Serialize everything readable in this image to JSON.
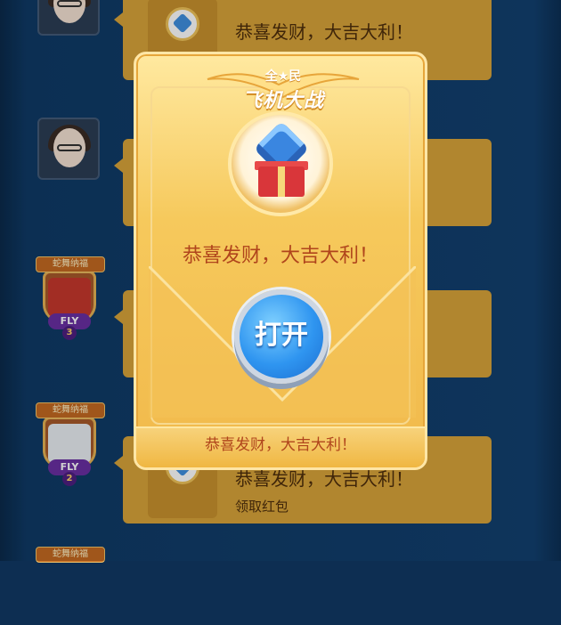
{
  "chat": {
    "messages": [
      {
        "title": "恭喜发财，大吉大利！",
        "subtitle": ""
      },
      {
        "title": "",
        "subtitle": ""
      },
      {
        "title": "",
        "subtitle": ""
      },
      {
        "title": "恭喜发财，大吉大利！",
        "subtitle": "领取红包"
      }
    ],
    "frames": [
      {
        "badge": "蛇舞纳福",
        "fly": "FLY",
        "level": "3"
      },
      {
        "badge": "蛇舞纳福",
        "fly": "FLY",
        "level": "2"
      },
      {
        "badge": "蛇舞纳福"
      }
    ]
  },
  "dialog": {
    "logo_top": "全★民",
    "logo_main": "飞机大战",
    "message": "恭喜发财，大吉大利！",
    "open_label": "打开",
    "footer": "恭喜发财，大吉大利！"
  },
  "colors": {
    "accent_blue": "#2f95f0",
    "dialog_gold": "#f6c95c",
    "text_red": "#b0451c"
  },
  "icons": [
    "diamond-gift-icon",
    "gem-icon"
  ]
}
